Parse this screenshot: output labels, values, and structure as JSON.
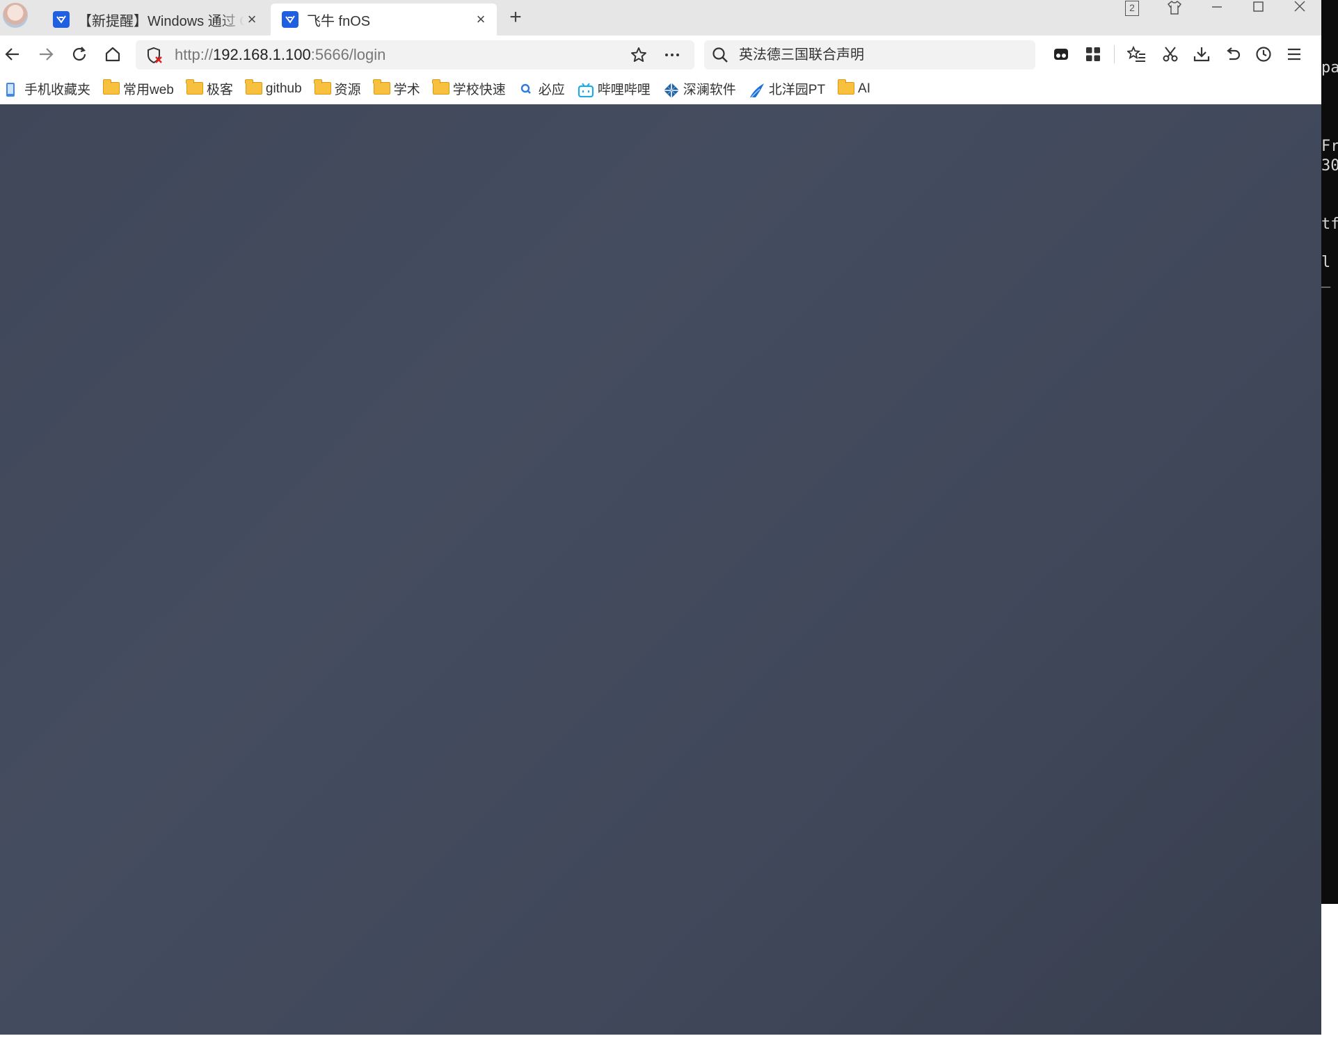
{
  "terminal": {
    "lines": [
      "pa",
      "Fr",
      "30",
      "tf",
      "l",
      "_"
    ]
  },
  "tabs": [
    {
      "title": "【新提醒】Windows 通过 Cl",
      "favicon": "fnos-logo-icon",
      "active": false
    },
    {
      "title": "飞牛 fnOS",
      "favicon": "fnos-logo-icon",
      "active": true
    }
  ],
  "window_controls": {
    "tab_count_badge": "2"
  },
  "address_bar": {
    "url_prefix": "http://",
    "url_host": "192.168.1.100",
    "url_suffix": ":5666/login"
  },
  "search": {
    "query": "英法德三国联合声明"
  },
  "bookmarks": [
    {
      "label": "手机收藏夹",
      "icon": "mobile-bookmark-icon"
    },
    {
      "label": "常用web",
      "icon": "folder-icon"
    },
    {
      "label": "极客",
      "icon": "folder-icon"
    },
    {
      "label": "github",
      "icon": "folder-icon"
    },
    {
      "label": "资源",
      "icon": "folder-icon"
    },
    {
      "label": "学术",
      "icon": "folder-icon"
    },
    {
      "label": "学校快速",
      "icon": "folder-icon"
    },
    {
      "label": "必应",
      "icon": "bing-search-icon"
    },
    {
      "label": "哔哩哔哩",
      "icon": "bilibili-icon"
    },
    {
      "label": "深澜软件",
      "icon": "srun-icon"
    },
    {
      "label": "北洋园PT",
      "icon": "pt-icon"
    },
    {
      "label": "AI",
      "icon": "folder-icon"
    }
  ],
  "colors": {
    "content_bg": "#424a5b",
    "tab_strip_bg": "#e6e6e6",
    "fnos_blue": "#1f5fe0",
    "folder_yellow": "#f8c03f"
  }
}
